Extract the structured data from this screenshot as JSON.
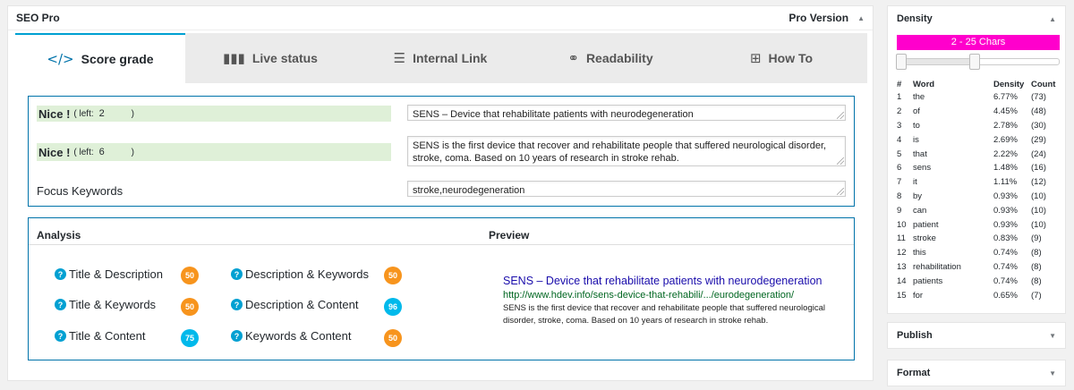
{
  "seo_panel": {
    "title": "SEO Pro",
    "version": "Pro Version"
  },
  "tabs": [
    {
      "label": "Score grade",
      "icon": "</>"
    },
    {
      "label": "Live status",
      "icon": "▮▮▮"
    },
    {
      "label": "Internal Link",
      "icon": "☰"
    },
    {
      "label": "Readability",
      "icon": "⚭"
    },
    {
      "label": "How To",
      "icon": "⊞"
    }
  ],
  "title_section": {
    "nice_label": "Nice !",
    "left_label": "( left:",
    "close": ")",
    "title_left": "2",
    "desc_left": "6",
    "title_value": "SENS – Device that rehabilitate patients with neurodegeneration",
    "desc_value": "SENS is the first device that recover and rehabilitate people that suffered neurological disorder, stroke, coma. Based on 10 years of research in stroke rehab.",
    "focus_label": "Focus Keywords",
    "focus_value": "stroke,neurodegeneration"
  },
  "analysis": {
    "heading": "Analysis",
    "preview_heading": "Preview",
    "metrics": [
      {
        "label": "Title & Description",
        "score": "50",
        "color": "#f7941d"
      },
      {
        "label": "Description & Keywords",
        "score": "50",
        "color": "#f7941d"
      },
      {
        "label": "Title & Keywords",
        "score": "50",
        "color": "#f7941d"
      },
      {
        "label": "Description & Content",
        "score": "96",
        "color": "#00b9eb"
      },
      {
        "label": "Title & Content",
        "score": "75",
        "color": "#00b9eb"
      },
      {
        "label": "Keywords & Content",
        "score": "50",
        "color": "#f7941d"
      }
    ],
    "preview": {
      "title": "SENS – Device that rehabilitate patients with neurodegeneration",
      "url": "http://www.hdev.info/sens-device-that-rehabili/.../eurodegeneration/",
      "desc": "SENS is the first device that recover and rehabilitate people that suffered neurological disorder, stroke, coma. Based on 10 years of research in stroke rehab."
    }
  },
  "density": {
    "title": "Density",
    "range_label": "2 - 25 Chars",
    "headers": [
      "#",
      "Word",
      "Density",
      "Count"
    ],
    "rows": [
      [
        "1",
        "the",
        "6.77%",
        "(73)"
      ],
      [
        "2",
        "of",
        "4.45%",
        "(48)"
      ],
      [
        "3",
        "to",
        "2.78%",
        "(30)"
      ],
      [
        "4",
        "is",
        "2.69%",
        "(29)"
      ],
      [
        "5",
        "that",
        "2.22%",
        "(24)"
      ],
      [
        "6",
        "sens",
        "1.48%",
        "(16)"
      ],
      [
        "7",
        "it",
        "1.11%",
        "(12)"
      ],
      [
        "8",
        "by",
        "0.93%",
        "(10)"
      ],
      [
        "9",
        "can",
        "0.93%",
        "(10)"
      ],
      [
        "10",
        "patient",
        "0.93%",
        "(10)"
      ],
      [
        "11",
        "stroke",
        "0.83%",
        "(9)"
      ],
      [
        "12",
        "this",
        "0.74%",
        "(8)"
      ],
      [
        "13",
        "rehabilitation",
        "0.74%",
        "(8)"
      ],
      [
        "14",
        "patients",
        "0.74%",
        "(8)"
      ],
      [
        "15",
        "for",
        "0.65%",
        "(7)"
      ]
    ]
  },
  "publish": {
    "title": "Publish"
  },
  "format": {
    "title": "Format"
  }
}
